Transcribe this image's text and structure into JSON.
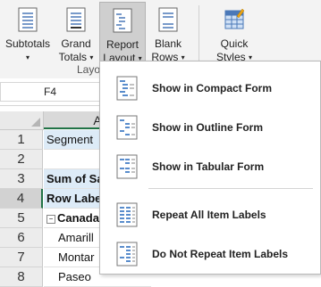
{
  "ribbon": {
    "buttons": [
      {
        "line1": "Subtotals",
        "line2": ""
      },
      {
        "line1": "Grand",
        "line2": "Totals"
      },
      {
        "line1": "Report",
        "line2": "Layout"
      },
      {
        "line1": "Blank",
        "line2": "Rows"
      },
      {
        "line1": "Quick",
        "line2": "Styles"
      }
    ],
    "group_label": "Layo"
  },
  "formula_bar": {
    "name_box": "F4"
  },
  "grid": {
    "column_header": "A",
    "rows": [
      {
        "num": "1",
        "value": "Segment"
      },
      {
        "num": "2",
        "value": ""
      },
      {
        "num": "3",
        "value": "Sum of Sa"
      },
      {
        "num": "4",
        "value": "Row Labe"
      },
      {
        "num": "5",
        "value": "Canada"
      },
      {
        "num": "6",
        "value": "Amarill"
      },
      {
        "num": "7",
        "value": "Montar"
      },
      {
        "num": "8",
        "value": "Paseo"
      }
    ]
  },
  "menu": {
    "items": [
      {
        "label": "Show in Compact Form"
      },
      {
        "label": "Show in Outline Form"
      },
      {
        "label": "Show in Tabular Form"
      },
      {
        "label": "Repeat All Item Labels"
      },
      {
        "label": "Do Not Repeat Item Labels"
      }
    ]
  },
  "colors": {
    "accent": "#217346",
    "header_blue": "#ddebf7",
    "icon_blue": "#2f6fbf"
  }
}
